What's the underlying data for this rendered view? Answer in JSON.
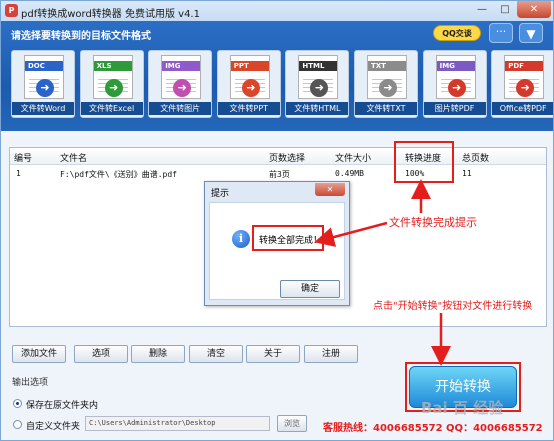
{
  "window": {
    "title": "pdf转换成word转换器 免费试用版 v4.1",
    "icon_name": "pdf-app-icon",
    "minimize": "—",
    "maximize": "□",
    "close": "✕"
  },
  "banner": {
    "heading": "请选择要转换到的目标文件格式",
    "qq_button": "QQ交谈",
    "chat_icon": "···",
    "menu_icon": "▼"
  },
  "tools": [
    {
      "band": "DOC",
      "label": "文件转Word",
      "band_color": "#2b63c6",
      "arrow_color": "#2b63c6"
    },
    {
      "band": "XLS",
      "label": "文件转Excel",
      "band_color": "#2e9a3a",
      "arrow_color": "#2e9a3a"
    },
    {
      "band": "IMG",
      "label": "文件转图片",
      "band_color": "#8e5bc9",
      "arrow_color": "#c04fb0"
    },
    {
      "band": "PPT",
      "label": "文件转PPT",
      "band_color": "#d9472b",
      "arrow_color": "#d9472b"
    },
    {
      "band": "HTML",
      "label": "文件转HTML",
      "band_color": "#333333",
      "arrow_color": "#555555"
    },
    {
      "band": "TXT",
      "label": "文件转TXT",
      "band_color": "#8b8b8b",
      "arrow_color": "#8b8b8b"
    },
    {
      "band": "IMG",
      "label": "图片转PDF",
      "band_color": "#7b5ac2",
      "arrow_color": "#d33a2c"
    },
    {
      "band": "PDF",
      "label": "Office转PDF",
      "band_color": "#d33a2c",
      "arrow_color": "#d33a2c"
    }
  ],
  "table": {
    "headers": [
      "编号",
      "文件名",
      "页数选择",
      "文件大小",
      "转换进度",
      "总页数"
    ],
    "rows": [
      [
        "1",
        "F:\\pdf文件\\《送别》曲谱.pdf",
        "前3页",
        "0.49MB",
        "100%",
        "11"
      ]
    ]
  },
  "dialog": {
    "title": "提示",
    "close": "✕",
    "message": "转换全部完成！",
    "ok": "确定"
  },
  "annotations": {
    "complete": "文件转换完成提示",
    "start_hint": "点击\"开始转换\"按钮对文件进行转换",
    "accent_color": "#e41d1d"
  },
  "buttons": {
    "add": "添加文件",
    "options": "选项",
    "delete": "删除",
    "clear": "清空",
    "about": "关于",
    "register": "注册"
  },
  "output": {
    "label": "输出选项",
    "keep": "保存在原文件夹内",
    "custom": "自定义文件夹",
    "path": "C:\\Users\\Administrator\\Desktop",
    "browse": "浏览",
    "keep_selected": true
  },
  "start": {
    "label": "开始转换",
    "hotline": "客服热线：4006685572 QQ：4006685572"
  },
  "watermark": "Bai 百 经验"
}
